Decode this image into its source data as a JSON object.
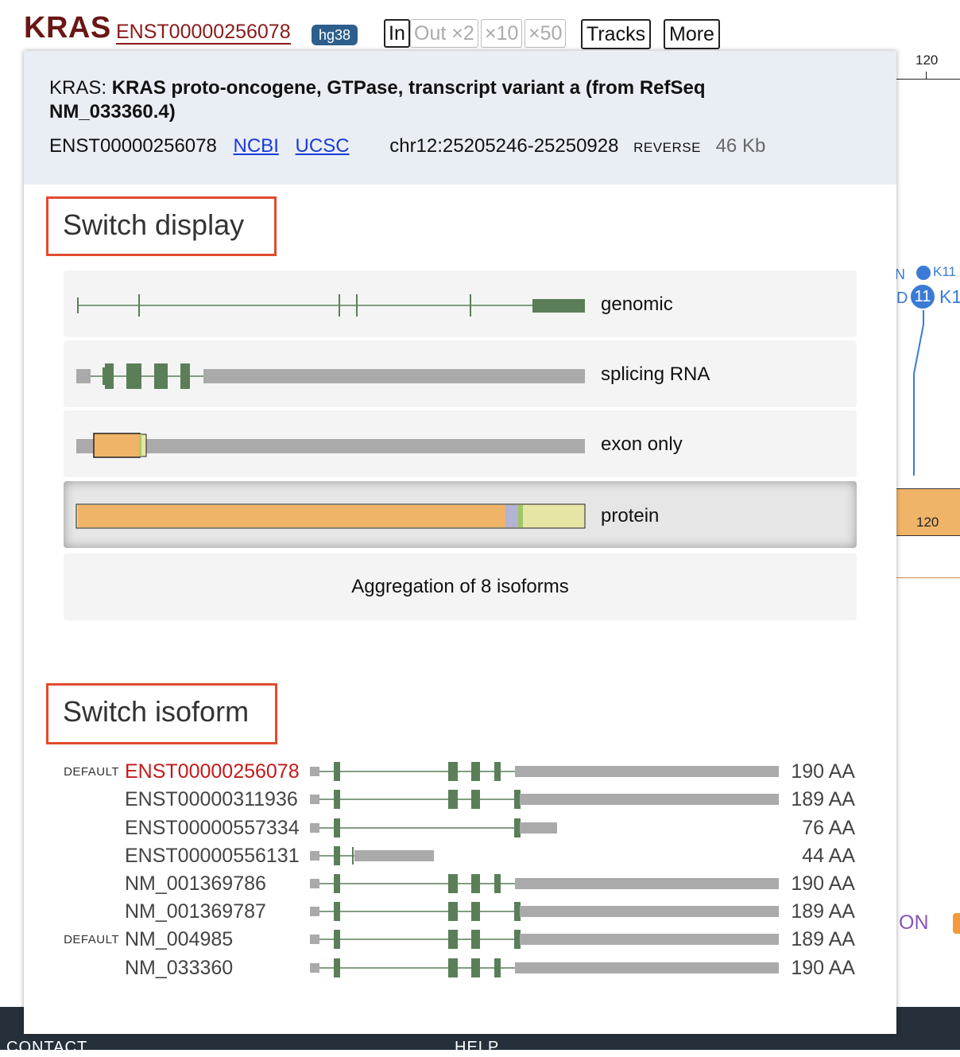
{
  "header": {
    "gene_symbol": "KRAS",
    "transcript_id": "ENST00000256078",
    "assembly": "hg38",
    "zoom": {
      "in": "In",
      "out2": "Out ×2",
      "x10": "×10",
      "x50": "×50"
    },
    "tracks_label": "Tracks",
    "more_label": "More"
  },
  "background": {
    "tick_label": "120",
    "lollipop_small_label": "K11",
    "lollipop_big_count": "11",
    "lollipop_big_label": "K1",
    "left_letter_top": "N",
    "left_letter_mid": "D",
    "domain_label": "120",
    "side_text": "ON",
    "footer_contact": "CONTACT",
    "footer_help": "HELP"
  },
  "popup": {
    "gene_symbol": "KRAS:",
    "description": "KRAS proto-oncogene, GTPase, transcript variant a (from RefSeq NM_033360.4)",
    "transcript_id": "ENST00000256078",
    "link_ncbi": "NCBI",
    "link_ucsc": "UCSC",
    "coordinates": "chr12:25205246-25250928",
    "strand": "REVERSE",
    "length": "46 Kb",
    "switch_display_title": "Switch display",
    "display_options": [
      {
        "label": "genomic",
        "selected": false
      },
      {
        "label": "splicing RNA",
        "selected": false
      },
      {
        "label": "exon only",
        "selected": false
      },
      {
        "label": "protein",
        "selected": true
      }
    ],
    "aggregation_label": "Aggregation of 8 isoforms",
    "switch_isoform_title": "Switch isoform",
    "isoforms": [
      {
        "tag": "DEFAULT",
        "name": "ENST00000256078",
        "aa": "190 AA",
        "current": true
      },
      {
        "tag": "",
        "name": "ENST00000311936",
        "aa": "189 AA",
        "current": false
      },
      {
        "tag": "",
        "name": "ENST00000557334",
        "aa": "76 AA",
        "current": false
      },
      {
        "tag": "",
        "name": "ENST00000556131",
        "aa": "44 AA",
        "current": false
      },
      {
        "tag": "",
        "name": "NM_001369786",
        "aa": "190 AA",
        "current": false
      },
      {
        "tag": "",
        "name": "NM_001369787",
        "aa": "189 AA",
        "current": false
      },
      {
        "tag": "DEFAULT",
        "name": "NM_004985",
        "aa": "189 AA",
        "current": false
      },
      {
        "tag": "",
        "name": "NM_033360",
        "aa": "190 AA",
        "current": false
      }
    ]
  },
  "colors": {
    "exon_green": "#5a7f58",
    "utr_gray": "#aaaaaa",
    "domain_orange": "#f0b469",
    "accent_red": "#e24a2e",
    "current_isoform": "#c41a1a"
  }
}
